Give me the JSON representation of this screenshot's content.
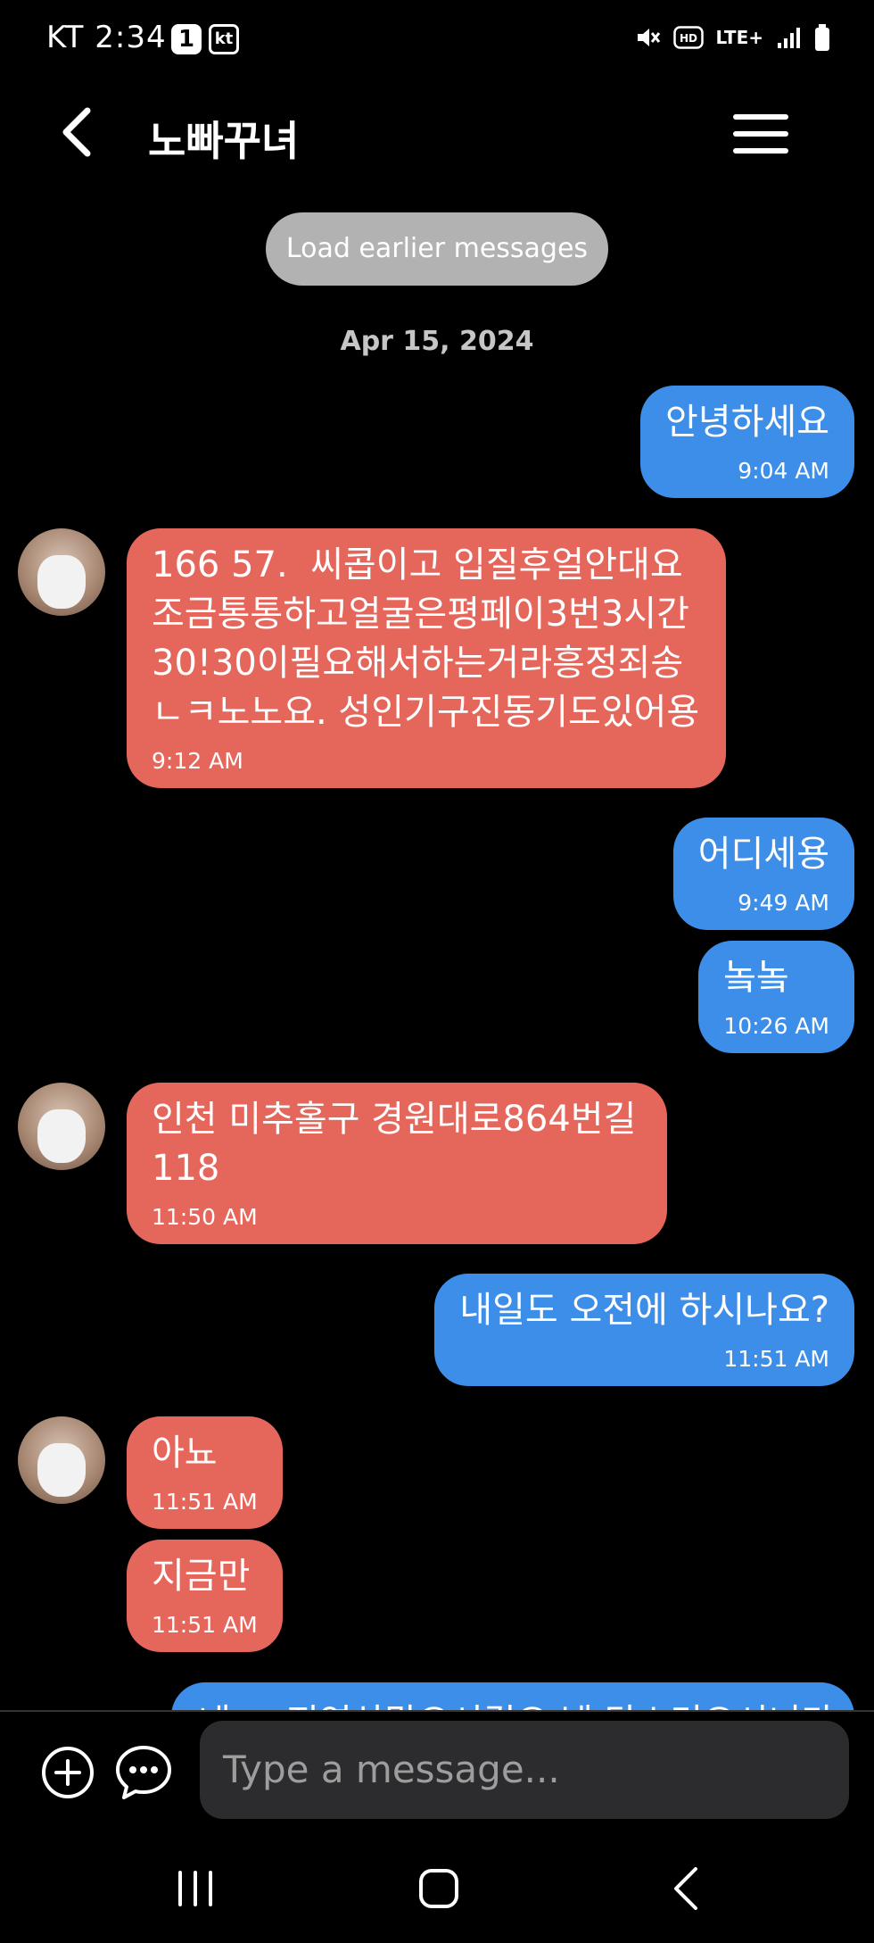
{
  "status_bar": {
    "carrier_time": "KT 2:34",
    "badge_one": "1",
    "badge_kt": "kt",
    "network": "LTE+"
  },
  "header": {
    "title": "노빠꾸녀"
  },
  "load_earlier": "Load earlier messages",
  "date_separator": "Apr 15, 2024",
  "messages": [
    {
      "dir": "out",
      "text": "안녕하세요",
      "time": "9:04 AM"
    },
    {
      "dir": "in",
      "text": "166 57.  씨콥이고 입질후얼안대요\n조금통통하고얼굴은평페이3번3시간\n30!30이필요해서하는거라흥정죄송\nㄴㅋ노노요. 성인기구진동기도있어용",
      "time": "9:12 AM"
    },
    {
      "dir": "out",
      "text": "어디세용",
      "time": "9:49 AM"
    },
    {
      "dir": "out",
      "text": "놐놐",
      "time": "10:26 AM"
    },
    {
      "dir": "in",
      "text": "인천 미추홀구 경원대로864번길\n118",
      "time": "11:50 AM"
    },
    {
      "dir": "out",
      "text": "내일도 오전에 하시나요?",
      "time": "11:51 AM"
    },
    {
      "dir": "in",
      "text": "아뇨",
      "time": "11:51 AM"
    },
    {
      "dir": "in",
      "text": "지금만",
      "time": "11:51 AM"
    }
  ],
  "partial_message": "네 ㅎ 진영삼말오시길요 넵 탕스리요시니다",
  "composer": {
    "placeholder": "Type a message..."
  },
  "colors": {
    "outgoing": "#3d8ee8",
    "incoming": "#e5675c",
    "background": "#000000"
  }
}
